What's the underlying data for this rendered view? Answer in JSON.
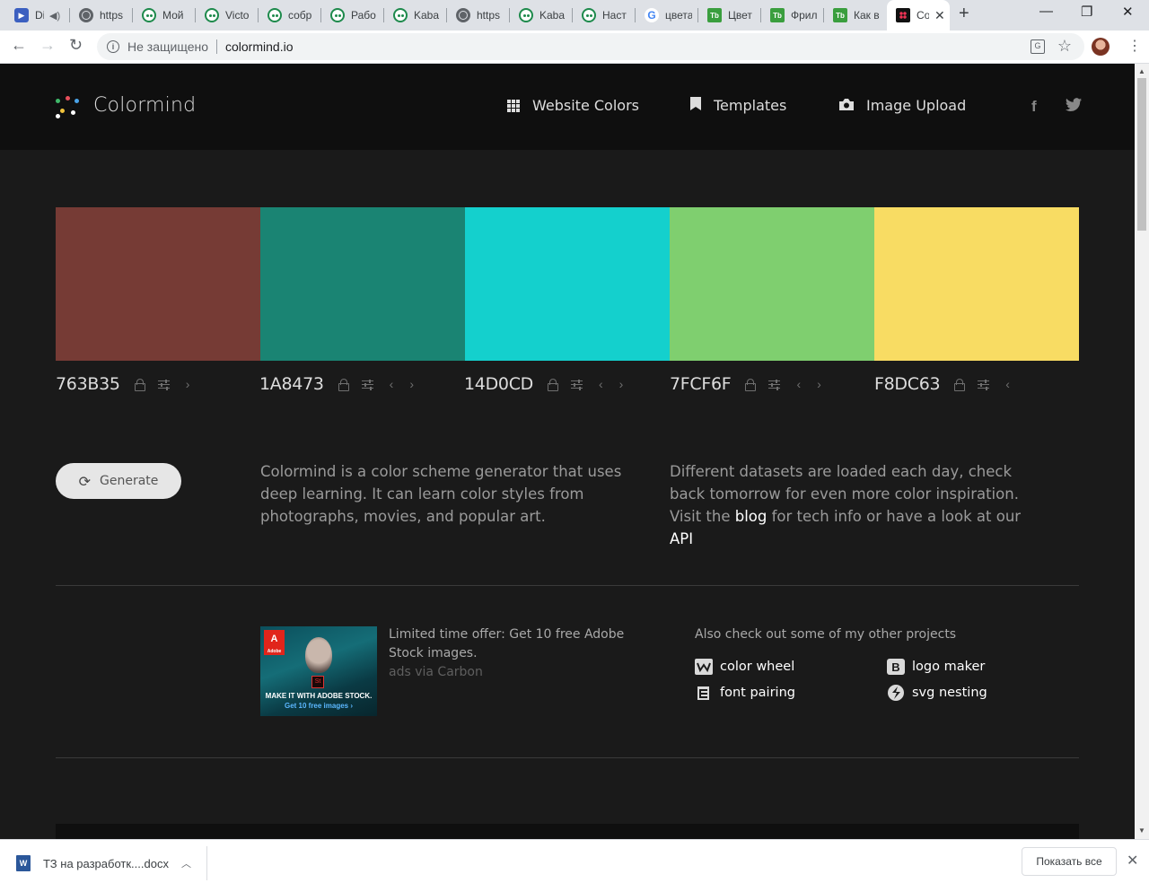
{
  "browser": {
    "tabs": [
      {
        "title": "Di",
        "favicon": "blue-square-icon"
      },
      {
        "title": "https",
        "favicon": "globe-icon"
      },
      {
        "title": "Мой",
        "favicon": "green-owl-icon"
      },
      {
        "title": "Victo",
        "favicon": "green-owl-icon"
      },
      {
        "title": "собр",
        "favicon": "green-owl-icon"
      },
      {
        "title": "Рабо",
        "favicon": "green-owl-icon"
      },
      {
        "title": "Kaba",
        "favicon": "green-owl-icon"
      },
      {
        "title": "https",
        "favicon": "globe-icon"
      },
      {
        "title": "Kaba",
        "favicon": "green-owl-icon"
      },
      {
        "title": "Наст",
        "favicon": "green-owl-icon"
      },
      {
        "title": "цвета",
        "favicon": "google-icon"
      },
      {
        "title": "Цвет",
        "favicon": "tb-icon"
      },
      {
        "title": "Фрил",
        "favicon": "tb-icon"
      },
      {
        "title": "Как в",
        "favicon": "tb-icon"
      },
      {
        "title": "Co",
        "favicon": "colormind-icon",
        "active": true
      }
    ],
    "omnibox": {
      "security_label": "Не защищено",
      "url": "colormind.io"
    }
  },
  "site": {
    "logo_text": "Colormind",
    "nav": [
      {
        "label": "Website Colors",
        "icon": "grid-icon"
      },
      {
        "label": "Templates",
        "icon": "bookmark-icon"
      },
      {
        "label": "Image Upload",
        "icon": "camera-icon"
      }
    ],
    "social": [
      {
        "icon": "facebook-icon",
        "glyph": "f"
      },
      {
        "icon": "twitter-icon",
        "glyph": "t"
      }
    ],
    "palette": [
      {
        "hex": "763B35",
        "color": "#763B35",
        "controls": [
          "lock",
          "adjust",
          "right"
        ]
      },
      {
        "hex": "1A8473",
        "color": "#1A8473",
        "controls": [
          "lock",
          "adjust",
          "left",
          "right"
        ]
      },
      {
        "hex": "14D0CD",
        "color": "#14D0CD",
        "controls": [
          "lock",
          "adjust",
          "left",
          "right"
        ]
      },
      {
        "hex": "7FCF6F",
        "color": "#7FCF6F",
        "controls": [
          "lock",
          "adjust",
          "left",
          "right"
        ]
      },
      {
        "hex": "F8DC63",
        "color": "#F8DC63",
        "controls": [
          "lock",
          "adjust",
          "left"
        ]
      }
    ],
    "generate_label": "Generate",
    "description_1": "Colormind is a color scheme generator that uses deep learning. It can learn color styles from photographs, movies, and popular art.",
    "description_2_a": "Different datasets are loaded each day, check back tomorrow for even more color inspiration. Visit the ",
    "description_2_link_blog": "blog",
    "description_2_b": " for tech info or have a look at our ",
    "description_2_link_api": "API",
    "ad": {
      "image_line1": "MAKE IT WITH ADOBE STOCK.",
      "image_line2": "Get 10 free images ›",
      "adobe_mark": "A",
      "adobe_word": "Adobe",
      "stock_mark": "St",
      "text": "Limited time offer: Get 10 free Adobe Stock images.",
      "via": "ads via Carbon"
    },
    "other_projects": {
      "title": "Also check out some of my other projects",
      "items": [
        {
          "label": "color wheel",
          "icon": "color-wheel-icon"
        },
        {
          "label": "logo maker",
          "icon": "logo-maker-icon"
        },
        {
          "label": "font pairing",
          "icon": "font-pairing-icon"
        },
        {
          "label": "svg nesting",
          "icon": "svg-nesting-icon"
        }
      ]
    }
  },
  "downloads": {
    "file_name": "ТЗ на разработк....docx",
    "file_icon": "W",
    "show_all_label": "Показать все"
  }
}
